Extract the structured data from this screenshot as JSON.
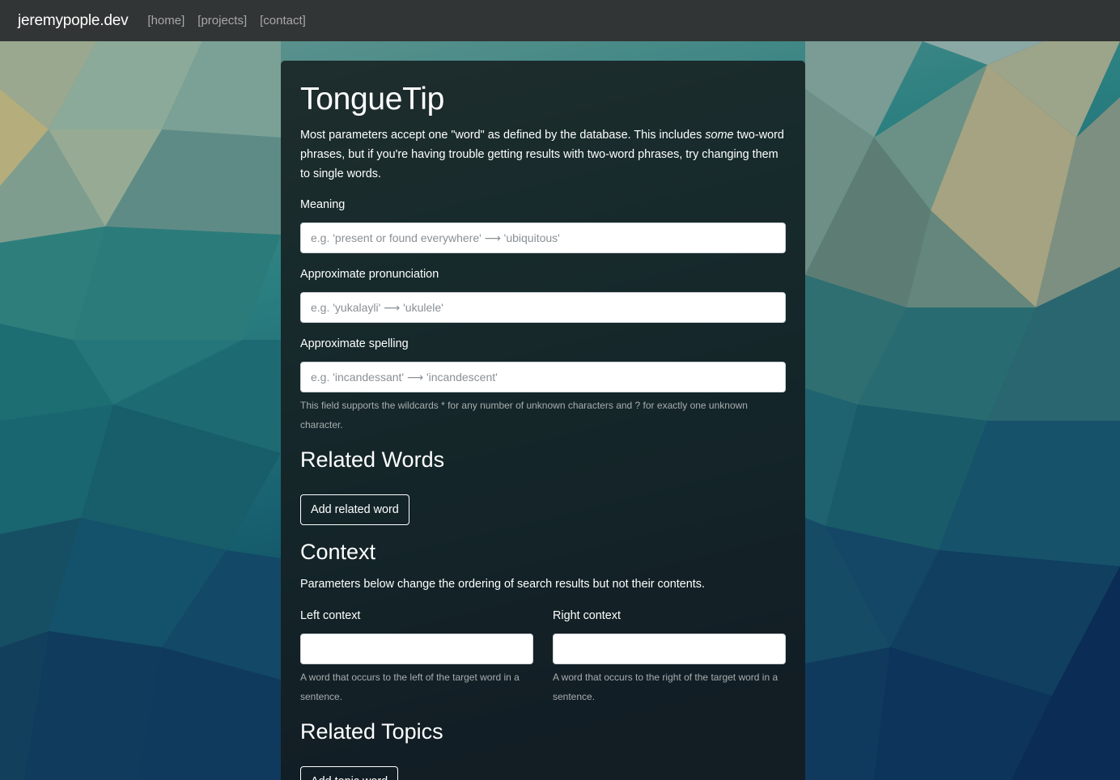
{
  "navbar": {
    "brand": "jeremypople.dev",
    "links": [
      "[home]",
      "[projects]",
      "[contact]"
    ]
  },
  "main": {
    "title": "TongueTip",
    "intro_before": "Most parameters accept one \"word\" as defined by the database. This includes ",
    "intro_em": "some",
    "intro_after": " two-word phrases, but if you're having trouble getting results with two-word phrases, try changing them to single words.",
    "meaning": {
      "label": "Meaning",
      "placeholder": "e.g. 'present or found everywhere' ⟶ 'ubiquitous'",
      "value": ""
    },
    "pronunciation": {
      "label": "Approximate pronunciation",
      "placeholder": "e.g. 'yukalayli' ⟶ 'ukulele'",
      "value": ""
    },
    "spelling": {
      "label": "Approximate spelling",
      "placeholder": "e.g. 'incandessant' ⟶ 'incandescent'",
      "value": "",
      "help": "This field supports the wildcards * for any number of unknown characters and ? for exactly one unknown character."
    },
    "related_words": {
      "heading": "Related Words",
      "add_button": "Add related word"
    },
    "context": {
      "heading": "Context",
      "description": "Parameters below change the ordering of search results but not their contents.",
      "left": {
        "label": "Left context",
        "value": "",
        "help": "A word that occurs to the left of the target word in a sentence."
      },
      "right": {
        "label": "Right context",
        "value": "",
        "help": "A word that occurs to the right of the target word in a sentence."
      }
    },
    "related_topics": {
      "heading": "Related Topics",
      "add_button": "Add topic word"
    }
  },
  "colors": {
    "navbar_bg": "#323535",
    "card_bg": "#141a1c",
    "nav_link": "#a7a9a9",
    "help_text": "#a8adaf"
  }
}
